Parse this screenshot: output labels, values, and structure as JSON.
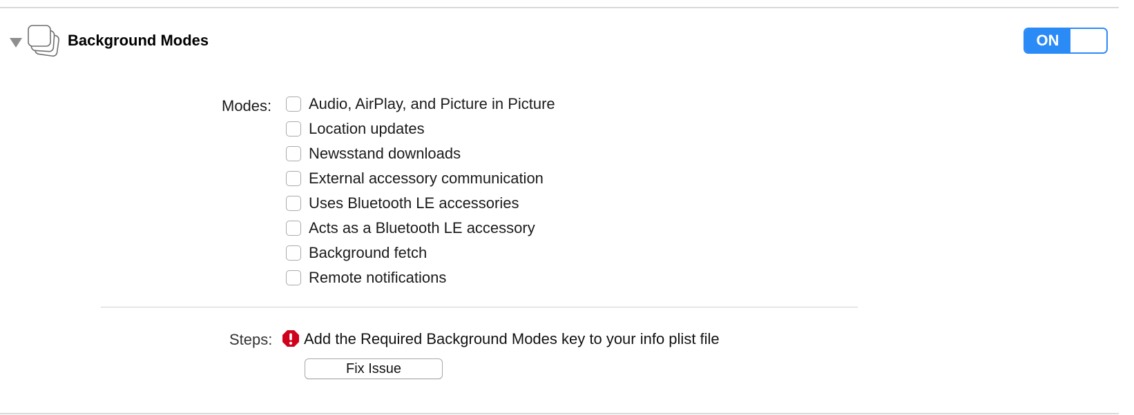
{
  "section": {
    "title": "Background Modes",
    "icon": "stacked-windows-icon",
    "disclosure_icon": "disclosure-triangle-down-icon",
    "expanded": true
  },
  "toggle": {
    "label": "ON",
    "on": true,
    "accent_color": "#2a8af6"
  },
  "modes": {
    "label": "Modes:",
    "items": [
      {
        "label": "Audio, AirPlay, and Picture in Picture",
        "checked": false
      },
      {
        "label": "Location updates",
        "checked": false
      },
      {
        "label": "Newsstand downloads",
        "checked": false
      },
      {
        "label": "External accessory communication",
        "checked": false
      },
      {
        "label": "Uses Bluetooth LE accessories",
        "checked": false
      },
      {
        "label": "Acts as a Bluetooth LE accessory",
        "checked": false
      },
      {
        "label": "Background fetch",
        "checked": false
      },
      {
        "label": "Remote notifications",
        "checked": false
      }
    ]
  },
  "steps": {
    "label": "Steps:",
    "items": [
      {
        "text": "Add the Required Background Modes key to your info plist file",
        "status_icon": "error-icon",
        "status_color": "#d0021b"
      }
    ],
    "fix_button_label": "Fix Issue"
  }
}
